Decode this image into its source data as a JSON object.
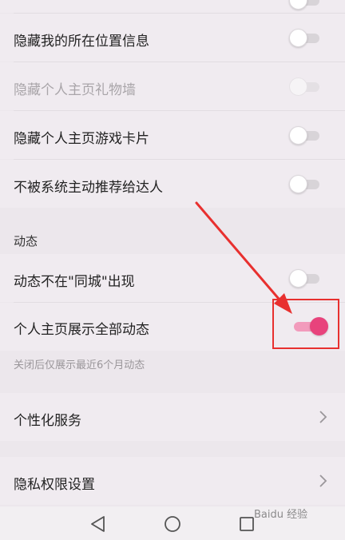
{
  "settings_top": [
    {
      "label": "隐藏我的所在位置信息",
      "enabled": true,
      "on": false
    },
    {
      "label": "隐藏个人主页礼物墙",
      "enabled": false,
      "on": false
    },
    {
      "label": "隐藏个人主页游戏卡片",
      "enabled": true,
      "on": false
    },
    {
      "label": "不被系统主动推荐给达人",
      "enabled": true,
      "on": false
    }
  ],
  "dynamics": {
    "section_title": "动态",
    "items": [
      {
        "label": "动态不在\"同城\"出现",
        "on": false
      },
      {
        "label": "个人主页展示全部动态",
        "on": true
      }
    ],
    "hint": "关闭后仅展示最近6个月动态"
  },
  "links": [
    {
      "label": "个性化服务",
      "icon": "chevron-right-icon"
    },
    {
      "label": "隐私权限设置",
      "icon": "chevron-right-icon"
    }
  ],
  "nav": {
    "back": "triangle-back-icon",
    "home": "circle-home-icon",
    "recents": "square-recents-icon"
  },
  "colors": {
    "accent": "#e8437c",
    "annotation": "#e8302f"
  },
  "watermark": "Baidu 经验"
}
